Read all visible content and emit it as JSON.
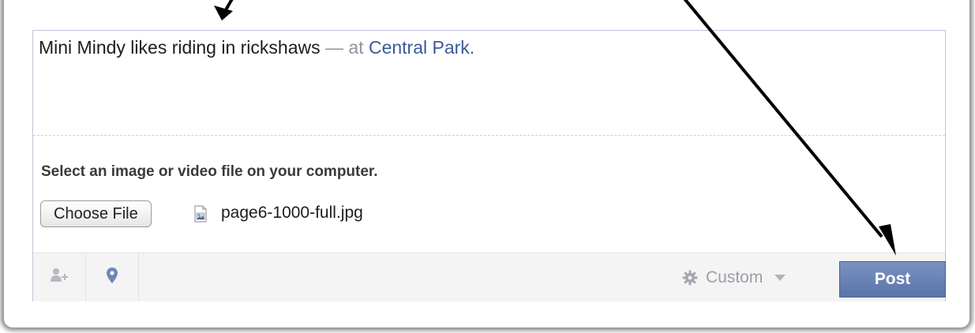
{
  "composer": {
    "status_main": "Mini Mindy likes riding in rickshaws",
    "status_separator": " — at ",
    "status_place": "Central Park",
    "status_end": "."
  },
  "upload": {
    "prompt": "Select an image or video file on your computer.",
    "choose_label": "Choose File",
    "file_name": "page6-1000-full.jpg"
  },
  "toolbar": {
    "tag_icon": "tag-people-icon",
    "location_icon": "location-pin-icon",
    "audience_label": "Custom",
    "post_label": "Post"
  },
  "colors": {
    "link_blue": "#3b5998",
    "post_button": "#6a83b6",
    "icon_gray": "#b5b9c0"
  }
}
